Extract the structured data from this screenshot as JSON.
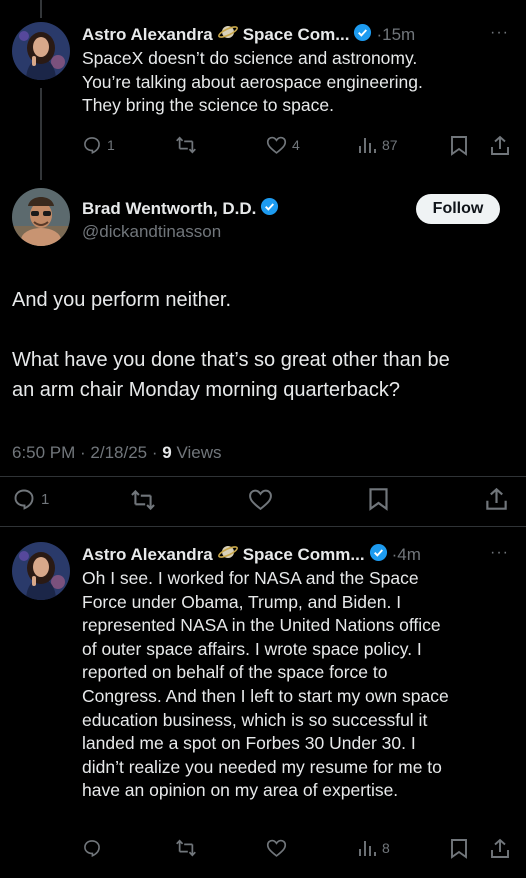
{
  "tweet1": {
    "name": "Astro Alexandra",
    "community": "Space Com...",
    "time": "15m",
    "more_label": "···",
    "lines": [
      "SpaceX doesn’t do science and astronomy.",
      "You’re talking about aerospace engineering.",
      "They bring the science to space."
    ],
    "replies": "1",
    "reposts": "",
    "likes": "4",
    "views": "87"
  },
  "main": {
    "name": "Brad Wentworth, D.D.",
    "handle": "@dickandtinasson",
    "follow_label": "Follow",
    "para1": "And you perform neither.",
    "para2_lines": [
      "What have you done that’s so great other than be",
      "an arm chair Monday morning quarterback?"
    ],
    "timestamp": "6:50 PM · 2/18/25 · ",
    "views_count": "9",
    "views_label": " Views",
    "replies": "1"
  },
  "tweet2": {
    "name": "Astro Alexandra",
    "community": "Space Comm...",
    "time": "4m",
    "more_label": "···",
    "lines": [
      "Oh I see. I worked for NASA and the Space",
      "Force under Obama, Trump, and Biden. I",
      "represented NASA in the United Nations office",
      "of outer space affairs. I wrote space policy. I",
      "reported on behalf of the space force to",
      "Congress. And then I left to start my own space",
      "education business, which is so successful it",
      "landed me a spot on Forbes 30 Under 30. I",
      "didn’t realize you needed my resume for me to",
      "have an opinion on my area of expertise."
    ],
    "views": "8"
  },
  "colors": {
    "background": "#000000",
    "text": "#e7e9ea",
    "secondary": "#71767b",
    "verified": "#1d9bf0",
    "follow_bg": "#eff3f4"
  }
}
